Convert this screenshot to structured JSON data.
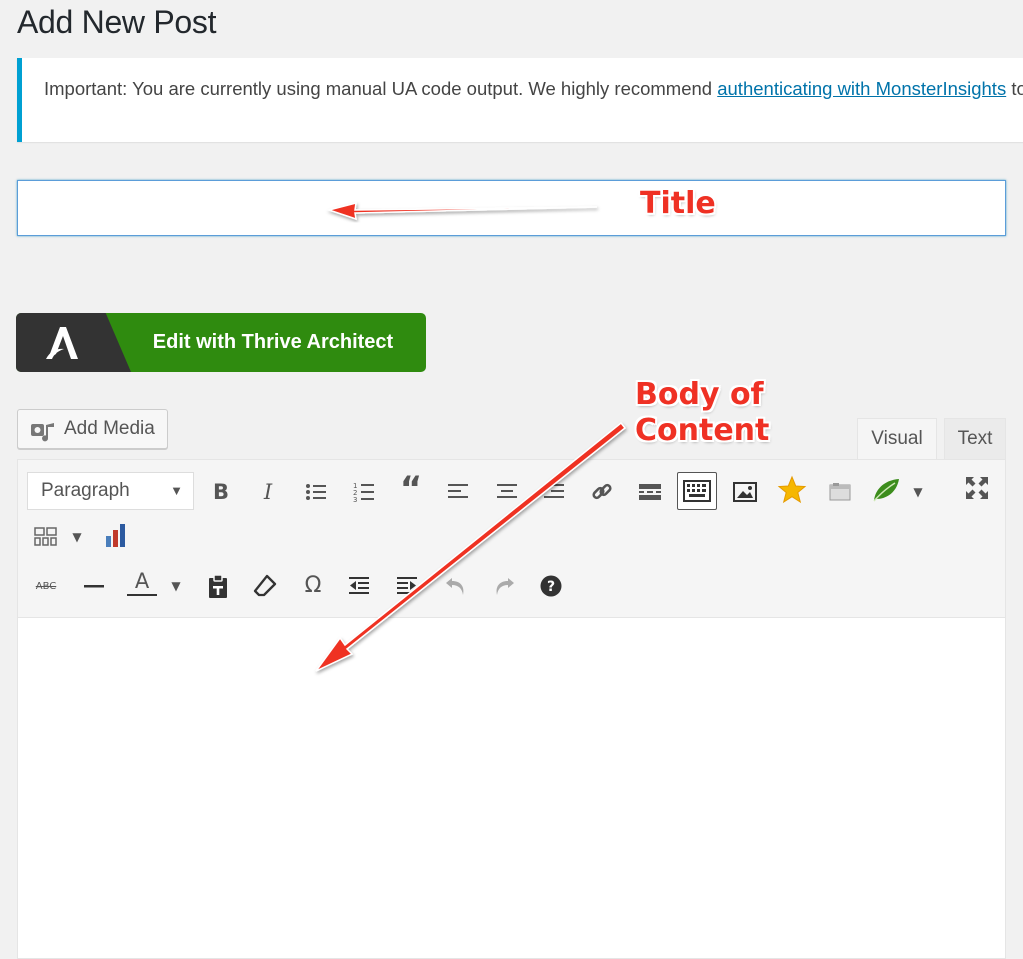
{
  "page": {
    "title": "Add New Post"
  },
  "notice": {
    "text_before": "Important: You are currently using manual UA code output. We highly recommend ",
    "link_text": "authenticating with MonsterInsights",
    "text_after": " to use the new reporting area and take advantage of new MonsterInsights features.",
    "accent_color": "#00a0d2"
  },
  "title_field": {
    "value": "",
    "placeholder": ""
  },
  "thrive": {
    "label": "Edit with Thrive Architect",
    "color": "#2f8b0f",
    "logo_icon": "thrive-architect-logo-icon"
  },
  "media": {
    "label": "Add Media",
    "icon": "add-media-icon"
  },
  "tabs": [
    {
      "label": "Visual",
      "active": true
    },
    {
      "label": "Text",
      "active": false
    }
  ],
  "toolbar": {
    "format_value": "Paragraph",
    "bold": "B",
    "italic": "I",
    "quote": "“",
    "special_char": "Ω",
    "help": "?",
    "strike_label": "ABC",
    "text_color": "A"
  },
  "annotations": {
    "title_label": "Title",
    "body_label": "Body of Content",
    "color": "#ef3124"
  }
}
